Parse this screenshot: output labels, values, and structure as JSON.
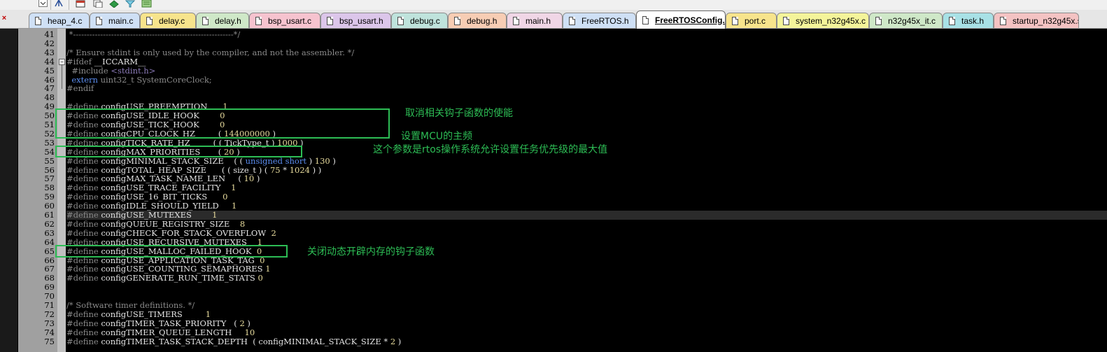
{
  "toolbar": {
    "buttons": [
      "chevron-down-icon",
      "hierarchy-icon",
      "window-icon",
      "copy-icon",
      "diamond-icon",
      "filter-icon",
      "map-icon"
    ]
  },
  "tabs": [
    {
      "label": "heap_4.c",
      "color": "#cfe0f5",
      "active": false
    },
    {
      "label": "main.c",
      "color": "#cfe0f5",
      "active": false
    },
    {
      "label": "delay.c",
      "color": "#f7e48c",
      "active": false
    },
    {
      "label": "delay.h",
      "color": "#cfe8c8",
      "active": false
    },
    {
      "label": "bsp_usart.c",
      "color": "#f6c3cf",
      "active": false
    },
    {
      "label": "bsp_usart.h",
      "color": "#dcc6ea",
      "active": false
    },
    {
      "label": "debug.c",
      "color": "#bfe3dc",
      "active": false
    },
    {
      "label": "debug.h",
      "color": "#f7cdb4",
      "active": false
    },
    {
      "label": "main.h",
      "color": "#f0d6e6",
      "active": false
    },
    {
      "label": "FreeRTOS.h",
      "color": "#cfe0f5",
      "active": false
    },
    {
      "label": "FreeRTOSConfig.h",
      "color": "#ffffff",
      "active": true
    },
    {
      "label": "port.c",
      "color": "#f7e48c",
      "active": false
    },
    {
      "label": "system_n32g45x.c",
      "color": "#f4f49a",
      "active": false
    },
    {
      "label": "n32g45x_it.c",
      "color": "#cfe8c8",
      "active": false
    },
    {
      "label": "task.h",
      "color": "#a8e1e6",
      "active": false
    },
    {
      "label": "startup_n32g45x.s",
      "color": "#f4c3c3",
      "active": false
    }
  ],
  "close_glyph": "×",
  "fold_glyph": "−",
  "editor": {
    "line_numbers": [
      "41",
      "42",
      "43",
      "44",
      "45",
      "46",
      "47",
      "48",
      "49",
      "50",
      "51",
      "52",
      "53",
      "54",
      "55",
      "56",
      "57",
      "58",
      "59",
      "60",
      "61",
      "62",
      "63",
      "64",
      "65",
      "66",
      "67",
      "68",
      "69",
      "70",
      "71",
      "72",
      "73",
      "74",
      "75"
    ],
    "lines": [
      " *-----------------------------------------------------------*/",
      "",
      "/* Ensure stdint is only used by the compiler, and not the assembler. */",
      "#ifdef __ICCARM__",
      "  #include <stdint.h>",
      "  extern uint32_t SystemCoreClock;",
      "#endif",
      "",
      "#define configUSE_PREEMPTION      1",
      "#define configUSE_IDLE_HOOK        0",
      "#define configUSE_TICK_HOOK        0",
      "#define configCPU_CLOCK_HZ         ( 144000000 )",
      "#define configTICK_RATE_HZ         ( ( TickType_t ) 1000 )",
      "#define configMAX_PRIORITIES       ( 20 )",
      "#define configMINIMAL_STACK_SIZE    ( ( unsigned short ) 130 )",
      "#define configTOTAL_HEAP_SIZE      ( ( size_t ) ( 75 * 1024 ) )",
      "#define configMAX_TASK_NAME_LEN     ( 10 )",
      "#define configUSE_TRACE_FACILITY    1",
      "#define configUSE_16_BIT_TICKS      0",
      "#define configIDLE_SHOULD_YIELD     1",
      "#define configUSE_MUTEXES        1",
      "#define configQUEUE_REGISTRY_SIZE    8",
      "#define configCHECK_FOR_STACK_OVERFLOW  2",
      "#define configUSE_RECURSIVE_MUTEXES    1",
      "#define configUSE_MALLOC_FAILED_HOOK  0",
      "#define configUSE_APPLICATION_TASK_TAG  0",
      "#define configUSE_COUNTING_SEMAPHORES 1",
      "#define configGENERATE_RUN_TIME_STATS 0",
      "",
      "",
      "/* Software timer definitions. */",
      "#define configUSE_TIMERS         1",
      "#define configTIMER_TASK_PRIORITY   ( 2 )",
      "#define configTIMER_QUEUE_LENGTH     10",
      "#define configTIMER_TASK_STACK_DEPTH  ( configMINIMAL_STACK_SIZE * 2 )"
    ]
  },
  "annotations": [
    {
      "text": "取消相关钩子函数的使能"
    },
    {
      "text": "设置MCU的主频"
    },
    {
      "text": "这个参数是rtos操作系统允许设置任务优先级的最大值"
    },
    {
      "text": "关闭动态开辟内存的钩子函数"
    }
  ],
  "colors": {
    "annotation": "#2dbd55",
    "editor_bg": "#000000",
    "gutter": "#a0a0a0",
    "number": "#e6da9c",
    "keyword": "#5b8def",
    "comment": "#8a8a8a"
  }
}
